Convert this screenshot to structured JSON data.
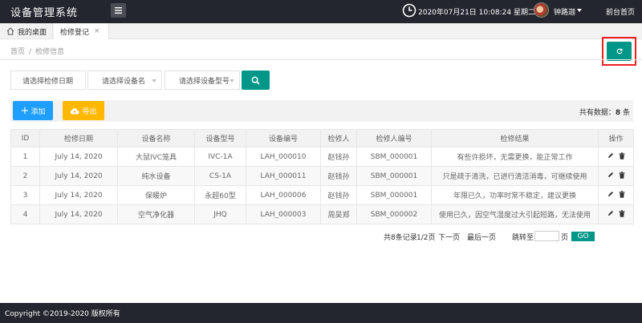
{
  "header": {
    "app_title": "设备管理系统",
    "menu_icon": "hamburger-icon",
    "datetime": "2020年07月21日 10:08:24 星期二",
    "username": "钟路迦",
    "front_link": "前台首页"
  },
  "tabs": {
    "home_label": "我的桌面",
    "active_label": "检修登记",
    "close_glyph": "×"
  },
  "breadcrumb": {
    "home": "首页",
    "separator": "/",
    "current": "检修信息"
  },
  "filters": {
    "date_placeholder": "请选择检修日期",
    "name_placeholder": "请选择设备名",
    "model_placeholder": "请选择设备型号"
  },
  "toolbar": {
    "add_label": "添加",
    "export_label": "导出",
    "total_label": "共有数据：",
    "total_count": "8",
    "total_unit": "条"
  },
  "table": {
    "headers": [
      "ID",
      "检修日期",
      "设备名称",
      "设备型号",
      "设备编号",
      "检修人",
      "检修人编号",
      "检修结果",
      "操作"
    ],
    "rows": [
      {
        "id": "1",
        "date": "July 14, 2020",
        "name": "大鼠IVC笼具",
        "model": "IVC-1A",
        "code": "LAH_000010",
        "person": "赵钱孙",
        "person_code": "SBM_000001",
        "result": "有些许损坏，无需更换，能正常工作"
      },
      {
        "id": "2",
        "date": "July 14, 2020",
        "name": "纯水设备",
        "model": "CS-1A",
        "code": "LAH_000011",
        "person": "赵钱孙",
        "person_code": "SBM_000001",
        "result": "只是疏于清洗，已进行清洁消毒，可继续使用"
      },
      {
        "id": "3",
        "date": "July 14, 2020",
        "name": "保暖炉",
        "model": "永超60型",
        "code": "LAH_000006",
        "person": "赵钱孙",
        "person_code": "SBM_000001",
        "result": "年限已久，功率时常不稳定，建议更换"
      },
      {
        "id": "4",
        "date": "July 14, 2020",
        "name": "空气净化器",
        "model": "JHQ",
        "code": "LAH_000003",
        "person": "周吴郑",
        "person_code": "SBM_000002",
        "result": "使用已久，因空气湿度过大引起短路，无法使用"
      }
    ]
  },
  "pager": {
    "count": "共8条记录",
    "current": "1/2页",
    "next": "下一页",
    "last": "最后一页",
    "jump": "跳转至",
    "unit": "页",
    "go": "GO"
  },
  "footer": {
    "copyright": "Copyright ©2019-2020 版权所有"
  },
  "colors": {
    "dark": "#23262e",
    "primary": "#009688",
    "blue": "#1e9fff",
    "orange": "#ffb800",
    "highlight_red": "#e22222"
  }
}
